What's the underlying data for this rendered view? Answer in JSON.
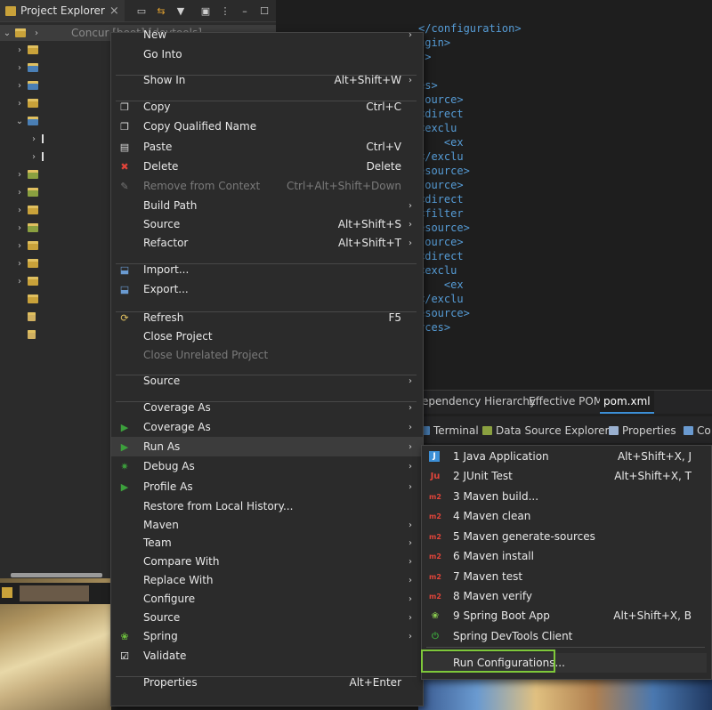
{
  "project_explorer": {
    "tab_label": "Project Explorer",
    "close_glyph": "×",
    "root_label": "Concur [boot] [devtools]"
  },
  "editor": {
    "code_lines": [
      "</configuration>",
      "ugin>",
      "s>",
      "",
      "es>",
      "source>",
      "<direct",
      "<exclu",
      "    <ex",
      "</exclu",
      "esource>",
      "source>",
      "<direct",
      "<filter",
      "esource>",
      "source>",
      "<direct",
      "<exclu",
      "    <ex",
      "</exclu",
      "esource>",
      "rces>"
    ],
    "tabs": [
      "ependency Hierarchy",
      "Effective POM",
      "pom.xml"
    ],
    "active_tab": "pom.xml"
  },
  "bottom_panel": {
    "tabs": [
      "Terminal",
      "Data Source Explorer",
      "Properties",
      "Co"
    ]
  },
  "context_menu": {
    "items": [
      {
        "label": "New",
        "shortcut": "",
        "submenu": true
      },
      {
        "label": "Go Into",
        "shortcut": "",
        "submenu": false
      },
      {
        "label": "Show In",
        "shortcut": "Alt+Shift+W",
        "submenu": true
      },
      {
        "label": "Copy",
        "shortcut": "Ctrl+C",
        "submenu": false
      },
      {
        "label": "Copy Qualified Name",
        "shortcut": "",
        "submenu": false
      },
      {
        "label": "Paste",
        "shortcut": "Ctrl+V",
        "submenu": false
      },
      {
        "label": "Delete",
        "shortcut": "Delete",
        "submenu": false
      },
      {
        "label": "Remove from Context",
        "shortcut": "Ctrl+Alt+Shift+Down",
        "submenu": false,
        "disabled": true
      },
      {
        "label": "Build Path",
        "shortcut": "",
        "submenu": true
      },
      {
        "label": "Source",
        "shortcut": "Alt+Shift+S",
        "submenu": true
      },
      {
        "label": "Refactor",
        "shortcut": "Alt+Shift+T",
        "submenu": true
      },
      {
        "label": "Import...",
        "shortcut": "",
        "submenu": false
      },
      {
        "label": "Export...",
        "shortcut": "",
        "submenu": false
      },
      {
        "label": "Refresh",
        "shortcut": "F5",
        "submenu": false
      },
      {
        "label": "Close Project",
        "shortcut": "",
        "submenu": false
      },
      {
        "label": "Close Unrelated Project",
        "shortcut": "",
        "submenu": false,
        "disabled": true
      },
      {
        "label": "Source",
        "shortcut": "",
        "submenu": true
      },
      {
        "label": "Coverage As",
        "shortcut": "",
        "submenu": true
      },
      {
        "label": "Coverage As",
        "shortcut": "",
        "submenu": true
      },
      {
        "label": "Run As",
        "shortcut": "",
        "submenu": true,
        "highlighted": true
      },
      {
        "label": "Debug As",
        "shortcut": "",
        "submenu": true
      },
      {
        "label": "Profile As",
        "shortcut": "",
        "submenu": true
      },
      {
        "label": "Restore from Local History...",
        "shortcut": "",
        "submenu": false
      },
      {
        "label": "Maven",
        "shortcut": "",
        "submenu": true
      },
      {
        "label": "Team",
        "shortcut": "",
        "submenu": true
      },
      {
        "label": "Compare With",
        "shortcut": "",
        "submenu": true
      },
      {
        "label": "Replace With",
        "shortcut": "",
        "submenu": true
      },
      {
        "label": "Configure",
        "shortcut": "",
        "submenu": true
      },
      {
        "label": "Source",
        "shortcut": "",
        "submenu": true
      },
      {
        "label": "Spring",
        "shortcut": "",
        "submenu": true
      },
      {
        "label": "Validate",
        "shortcut": "",
        "submenu": false
      },
      {
        "label": "Properties",
        "shortcut": "Alt+Enter",
        "submenu": false
      }
    ],
    "arrow_glyph": "›"
  },
  "run_as_submenu": {
    "items": [
      {
        "label": "1 Java Application",
        "shortcut": "Alt+Shift+X, J"
      },
      {
        "label": "2 JUnit Test",
        "shortcut": "Alt+Shift+X, T"
      },
      {
        "label": "3 Maven build...",
        "shortcut": ""
      },
      {
        "label": "4 Maven clean",
        "shortcut": ""
      },
      {
        "label": "5 Maven generate-sources",
        "shortcut": ""
      },
      {
        "label": "6 Maven install",
        "shortcut": ""
      },
      {
        "label": "7 Maven test",
        "shortcut": ""
      },
      {
        "label": "8 Maven verify",
        "shortcut": ""
      },
      {
        "label": "9 Spring Boot App",
        "shortcut": "Alt+Shift+X, B"
      },
      {
        "label": "Spring DevTools Client",
        "shortcut": ""
      },
      {
        "label": "Run Configurations...",
        "shortcut": ""
      }
    ],
    "icon_texts": {
      "java": "J",
      "junit": "Ju",
      "maven": "m2"
    }
  },
  "colors": {
    "highlight_box": "#7ec83a",
    "menu_bg": "#2b2b2b",
    "code_tag": "#569cd6"
  }
}
